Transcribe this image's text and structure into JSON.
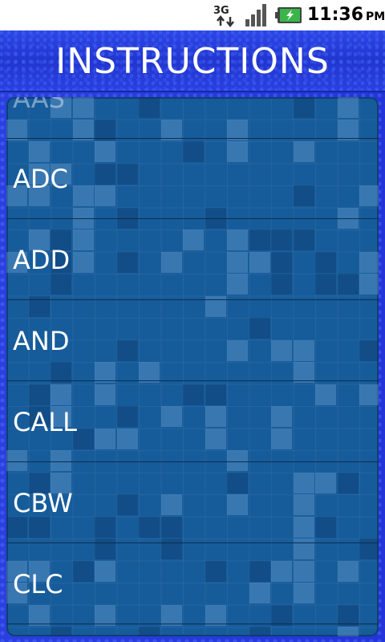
{
  "status_bar": {
    "network_icon": "3g-data-icon",
    "signal_icon": "signal-strength-icon",
    "battery_icon": "battery-charging-icon",
    "time": "11:36",
    "ampm": "PM"
  },
  "header": {
    "title": "INSTRUCTIONS"
  },
  "list": {
    "partial_top_label": "AAS",
    "items": [
      {
        "label": "ADC"
      },
      {
        "label": "ADD"
      },
      {
        "label": "AND"
      },
      {
        "label": "CALL"
      },
      {
        "label": "CBW"
      },
      {
        "label": "CLC"
      }
    ]
  },
  "colors": {
    "header_blue": "#2235cf",
    "list_background": "#175c9a",
    "text": "#ffffff"
  }
}
